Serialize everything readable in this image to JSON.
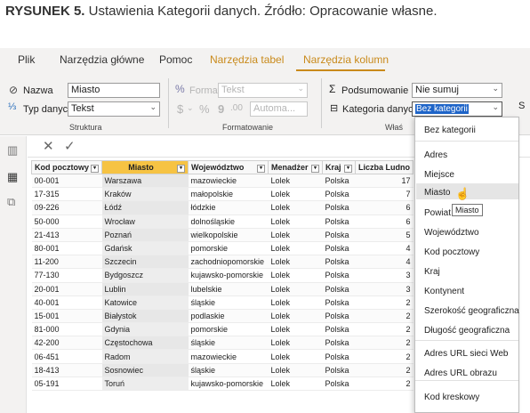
{
  "caption": {
    "bold": "RYSUNEK 5.",
    "text": " Ustawienia Kategorii danych. Źródło: Opracowanie własne."
  },
  "menu": {
    "file": "Plik",
    "home": "Narzędzia główne",
    "help": "Pomoc",
    "table_tools": "Narzędzia tabel",
    "column_tools": "Narzędzia kolumn"
  },
  "ribbon": {
    "name_label": "Nazwa",
    "name_value": "Miasto",
    "datatype_label": "Typ danych",
    "datatype_value": "Tekst",
    "structure_group": "Struktura",
    "format_label": "Format",
    "format_value": "Tekst",
    "currency": "$",
    "percent": "%",
    "thousands": "9",
    "decimals": ".00",
    "auto": "Automa...",
    "formatting_group": "Formatowanie",
    "summarize_label": "Podsumowanie",
    "summarize_value": "Nie sumuj",
    "category_label": "Kategoria danych",
    "category_value": "Bez kategorii",
    "properties_group_partial": "Właś",
    "sort_partial": "S"
  },
  "formula": {
    "cancel": "✕",
    "commit": "✓"
  },
  "table": {
    "headers": [
      "Kod pocztowy",
      "Miasto",
      "Województwo",
      "Menadżer",
      "Kraj",
      "Liczba Ludno"
    ],
    "rows": [
      [
        "00-001",
        "Warszawa",
        "mazowieckie",
        "Lolek",
        "Polska",
        "17"
      ],
      [
        "17-315",
        "Kraków",
        "małopolskie",
        "Lolek",
        "Polska",
        "7"
      ],
      [
        "09-226",
        "Łódź",
        "łódzkie",
        "Lolek",
        "Polska",
        "6"
      ],
      [
        "50-000",
        "Wrocław",
        "dolnośląskie",
        "Lolek",
        "Polska",
        "6"
      ],
      [
        "21-413",
        "Poznań",
        "wielkopolskie",
        "Lolek",
        "Polska",
        "5"
      ],
      [
        "80-001",
        "Gdańsk",
        "pomorskie",
        "Lolek",
        "Polska",
        "4"
      ],
      [
        "11-200",
        "Szczecin",
        "zachodniopomorskie",
        "Lolek",
        "Polska",
        "4"
      ],
      [
        "77-130",
        "Bydgoszcz",
        "kujawsko-pomorskie",
        "Lolek",
        "Polska",
        "3"
      ],
      [
        "20-001",
        "Lublin",
        "lubelskie",
        "Lolek",
        "Polska",
        "3"
      ],
      [
        "40-001",
        "Katowice",
        "śląskie",
        "Lolek",
        "Polska",
        "2"
      ],
      [
        "15-001",
        "Białystok",
        "podlaskie",
        "Lolek",
        "Polska",
        "2"
      ],
      [
        "81-000",
        "Gdynia",
        "pomorskie",
        "Lolek",
        "Polska",
        "2"
      ],
      [
        "42-200",
        "Częstochowa",
        "śląskie",
        "Lolek",
        "Polska",
        "2"
      ],
      [
        "06-451",
        "Radom",
        "mazowieckie",
        "Lolek",
        "Polska",
        "2"
      ],
      [
        "18-413",
        "Sosnowiec",
        "śląskie",
        "Lolek",
        "Polska",
        "2"
      ],
      [
        "05-191",
        "Toruń",
        "kujawsko-pomorskie",
        "Lolek",
        "Polska",
        "2"
      ]
    ]
  },
  "dropdown": {
    "items": [
      "Bez kategorii",
      "Adres",
      "Miejsce",
      "Miasto",
      "Powiat",
      "Województwo",
      "Kod pocztowy",
      "Kraj",
      "Kontynent",
      "Szerokość geograficzna",
      "Długość geograficzna",
      "Adres URL sieci Web",
      "Adres URL obrazu",
      "Kod kreskowy"
    ],
    "hovered": "Miasto",
    "tooltip": "Miasto"
  },
  "icons": {
    "name": "tag-icon",
    "datatype": "datatype-icon",
    "format": "format-icon",
    "sum": "sigma-icon",
    "category": "category-icon"
  }
}
